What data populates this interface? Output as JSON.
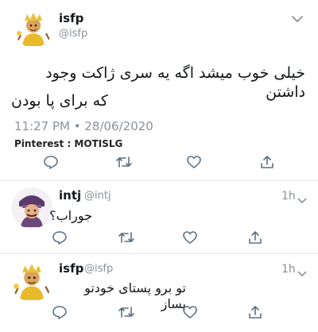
{
  "main_tweet": {
    "name": "isfp",
    "handle": "@isfp",
    "text_line1": "خیلی خوب میشد اگه یه سری ژاکت وجود داشتن",
    "text_line2": "که برای پا بودن",
    "timestamp": "11:27 PM • 28/06/2020",
    "watermark": "Pinterest : MOTISLG"
  },
  "replies": [
    {
      "name": "intj",
      "handle": "@intj",
      "time": "1h",
      "text": "جوراب؟"
    },
    {
      "name": "isfp",
      "handle": "@isfp",
      "time": "1h",
      "text": "تو برو پستای خودتو بساز"
    }
  ],
  "colors": {
    "text": "#14171a",
    "muted": "#8a9299",
    "divider": "#e1e8ed",
    "icon": "#5b7083"
  },
  "icons": [
    "chevron-down-icon",
    "reply-icon",
    "retweet-icon",
    "like-icon",
    "share-icon"
  ]
}
